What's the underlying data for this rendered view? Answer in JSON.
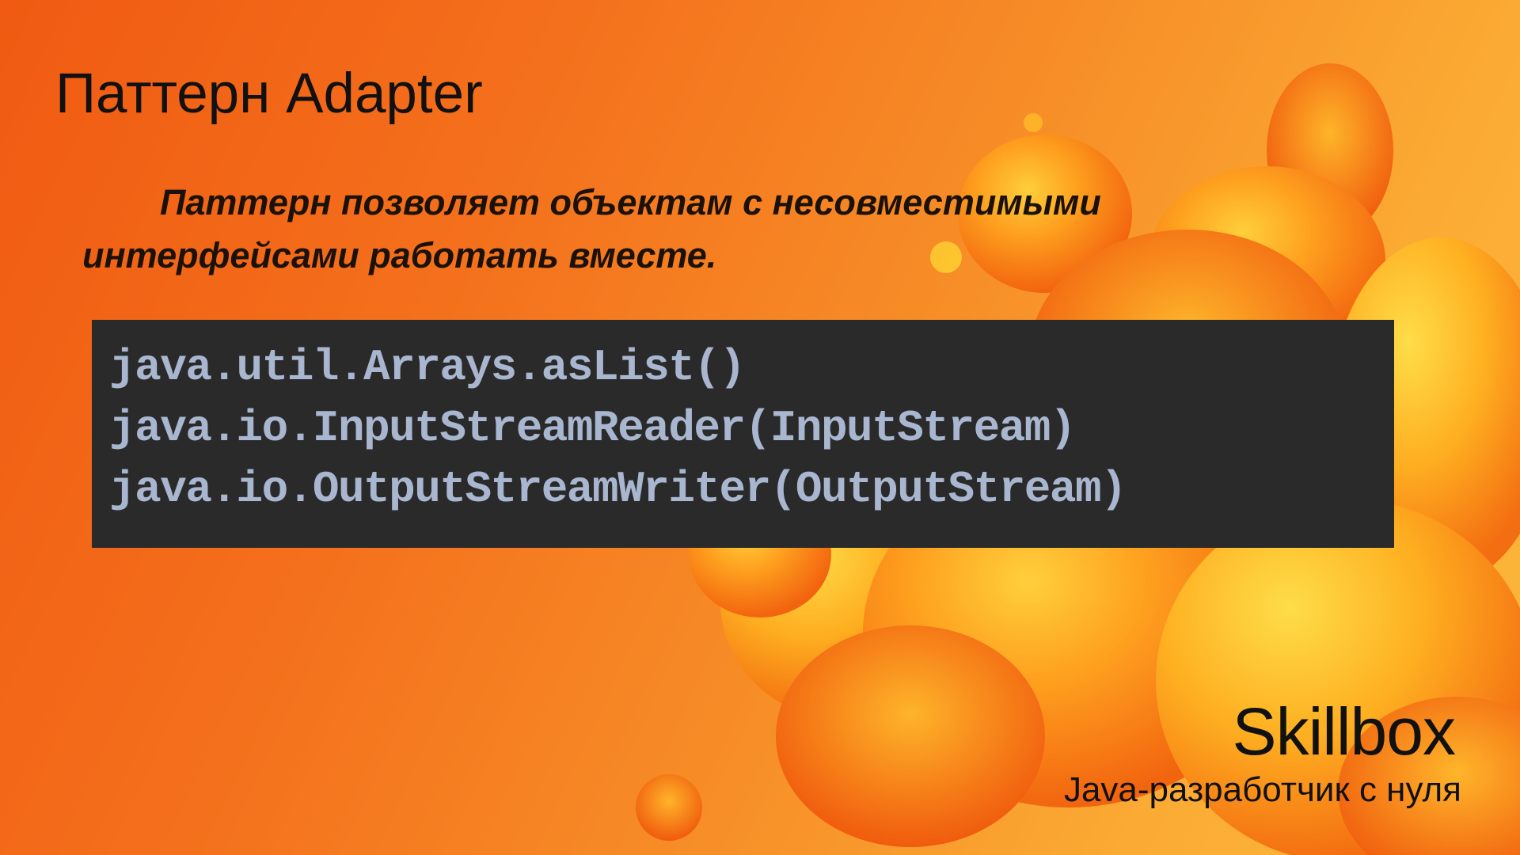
{
  "slide": {
    "title": "Паттерн Adapter",
    "lead": "Паттерн позволяет объектам с несовместимыми интерфейсами работать вместе.",
    "code_lines": [
      "java.util.Arrays.asList()",
      "java.io.InputStreamReader(InputStream)",
      "java.io.OutputStreamWriter(OutputStream)"
    ]
  },
  "footer": {
    "brand": "Skillbox",
    "course": "Java-разработчик с нуля"
  },
  "colors": {
    "background_start": "#f05a12",
    "background_end": "#fdb93a",
    "code_background": "#2a2a2a",
    "code_text": "#a9b6cf",
    "text": "#111111"
  }
}
